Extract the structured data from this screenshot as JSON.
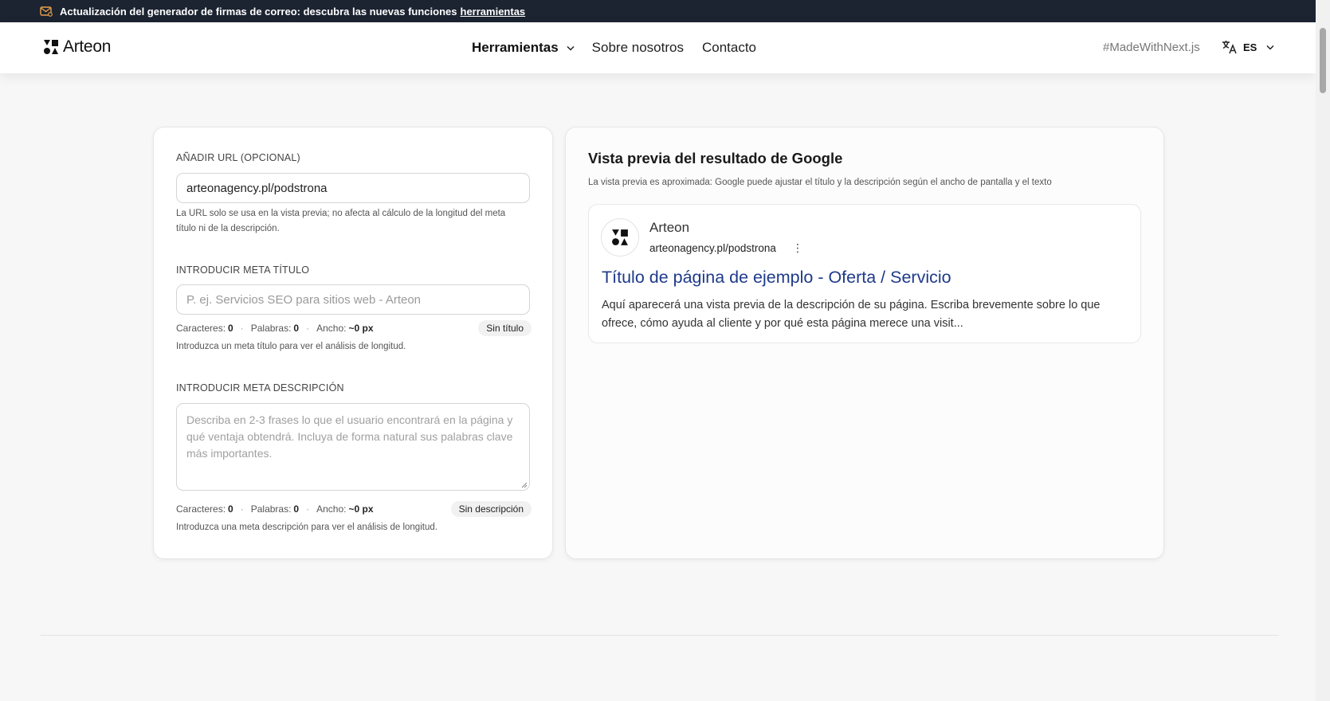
{
  "announcement": {
    "text": "Actualización del generador de firmas de correo: descubra las nuevas funciones",
    "link": "herramientas"
  },
  "header": {
    "brand": "Arteon",
    "nav": {
      "tools": "Herramientas",
      "about": "Sobre nosotros",
      "contact": "Contacto"
    },
    "made_with": "#MadeWithNext.js",
    "language": "ES"
  },
  "form": {
    "url": {
      "label": "AÑADIR URL (OPCIONAL)",
      "value": "arteonagency.pl/podstrona",
      "helper": "La URL solo se usa en la vista previa; no afecta al cálculo de la longitud del meta título ni de la descripción."
    },
    "title": {
      "label": "INTRODUCIR META TÍTULO",
      "placeholder": "P. ej. Servicios SEO para sitios web - Arteon",
      "stats": {
        "chars_label": "Caracteres:",
        "chars": "0",
        "words_label": "Palabras:",
        "words": "0",
        "width_label": "Ancho:",
        "width": "~0 px",
        "status": "Sin título"
      },
      "helper": "Introduzca un meta título para ver el análisis de longitud."
    },
    "description": {
      "label": "INTRODUCIR META DESCRIPCIÓN",
      "placeholder": "Describa en 2-3 frases lo que el usuario encontrará en la página y qué ventaja obtendrá. Incluya de forma natural sus palabras clave más importantes.",
      "stats": {
        "chars_label": "Caracteres:",
        "chars": "0",
        "words_label": "Palabras:",
        "words": "0",
        "width_label": "Ancho:",
        "width": "~0 px",
        "status": "Sin descripción"
      },
      "helper": "Introduzca una meta descripción para ver el análisis de longitud."
    }
  },
  "preview": {
    "title": "Vista previa del resultado de Google",
    "note": "La vista previa es aproximada: Google puede ajustar el título y la descripción según el ancho de pantalla y el texto",
    "result": {
      "site_name": "Arteon",
      "url": "arteonagency.pl/podstrona",
      "title": "Título de página de ejemplo - Oferta / Servicio",
      "description": "Aquí aparecerá una vista previa de la descripción de su página. Escriba brevemente sobre lo que ofrece, cómo ayuda al cliente y por qué esta página merece una visit..."
    }
  },
  "icons": {
    "announcement": "mail-icon",
    "nav_dropdown": "chevron-down-icon",
    "language": "translate-icon",
    "result_menu": "kebab-menu-icon"
  },
  "colors": {
    "topbar": "#1c2331",
    "serp_title": "#1e3a8a",
    "mail_icon": "#e8a24a"
  }
}
